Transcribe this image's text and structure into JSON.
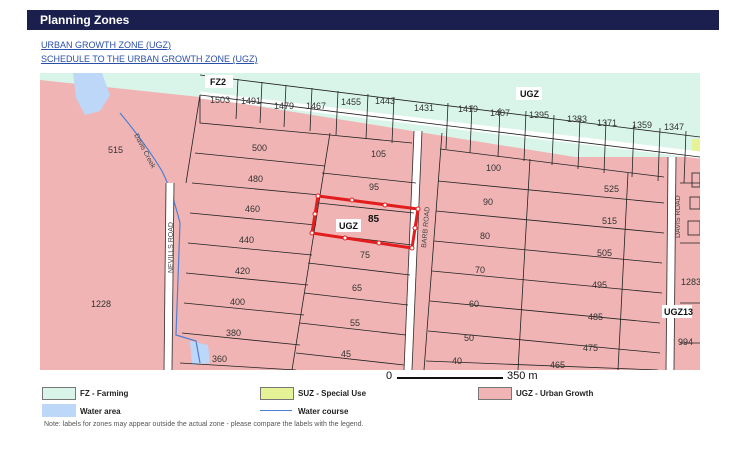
{
  "header": {
    "title": "Planning Zones"
  },
  "links": [
    {
      "label": "URBAN GROWTH ZONE (UGZ)"
    },
    {
      "label": "SCHEDULE TO THE URBAN GROWTH ZONE (UGZ)"
    }
  ],
  "map": {
    "zone_labels": {
      "fz2": "FZ2",
      "ugz_top": "UGZ",
      "ugz_subject": "UGZ",
      "ugz13": "UGZ13"
    },
    "lot_numbers": [
      "1503",
      "1491",
      "1479",
      "1467",
      "1455",
      "1443",
      "1431",
      "1419",
      "1407",
      "1395",
      "1383",
      "1371",
      "1359",
      "1347",
      "515",
      "500",
      "105",
      "100",
      "480",
      "95",
      "525",
      "460",
      "90",
      "515",
      "440",
      "80",
      "505",
      "420",
      "75",
      "70",
      "495",
      "400",
      "65",
      "60",
      "485",
      "380",
      "55",
      "50",
      "475",
      "360",
      "45",
      "40",
      "465",
      "1228",
      "1283",
      "994"
    ],
    "subject_lot": "85",
    "road_names": [
      "NEVILLS ROAD",
      "BARB ROAD",
      "DAVIS ROAD"
    ],
    "creek_name": "Davis Creek",
    "scale": {
      "start": "0",
      "end": "350 m"
    },
    "colors": {
      "urban_growth": "#f0b4b4",
      "farming": "#d9f5e9",
      "special_use": "#e6f296",
      "water": "#bcd7f7",
      "water_course": "#4f7fd0",
      "subject_outline": "#e21d1d"
    }
  },
  "legend": [
    {
      "label": "FZ - Farming",
      "color": "#d9f5e9"
    },
    {
      "label": "SUZ - Special Use",
      "color": "#e6f296"
    },
    {
      "label": "UGZ - Urban Growth",
      "color": "#f0b4b4"
    },
    {
      "label": "Water area",
      "color": "#bcd7f7"
    },
    {
      "label": "Water course",
      "color": "#4f7fd0"
    }
  ],
  "note": "Note: labels for zones may appear outside the actual zone - please compare the labels with the legend."
}
